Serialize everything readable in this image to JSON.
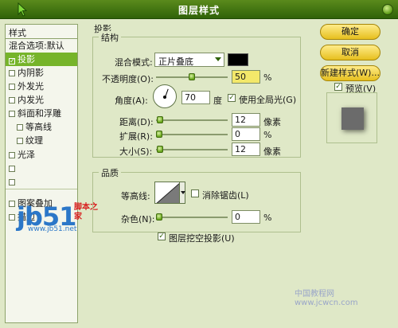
{
  "window": {
    "title": "图层样式"
  },
  "left_panel": {
    "header": "样式",
    "items": [
      {
        "label": "混合选项:默认",
        "checkbox": false,
        "sub": false,
        "selected": false
      },
      {
        "label": "投影",
        "checkbox": true,
        "checked": true,
        "sub": false,
        "selected": true
      },
      {
        "label": "内阴影",
        "checkbox": true,
        "checked": false,
        "sub": false,
        "selected": false
      },
      {
        "label": "外发光",
        "checkbox": true,
        "checked": false,
        "sub": false,
        "selected": false
      },
      {
        "label": "内发光",
        "checkbox": true,
        "checked": false,
        "sub": false,
        "selected": false
      },
      {
        "label": "斜面和浮雕",
        "checkbox": true,
        "checked": false,
        "sub": false,
        "selected": false
      },
      {
        "label": "等高线",
        "checkbox": true,
        "checked": false,
        "sub": true,
        "selected": false
      },
      {
        "label": "纹理",
        "checkbox": true,
        "checked": false,
        "sub": true,
        "selected": false
      },
      {
        "label": "光泽",
        "checkbox": true,
        "checked": false,
        "sub": false,
        "selected": false
      },
      {
        "label": "",
        "checkbox": true,
        "checked": false,
        "sub": false,
        "selected": false
      },
      {
        "label": "",
        "checkbox": true,
        "checked": false,
        "sub": false,
        "selected": false
      },
      {
        "label": "图案叠加",
        "checkbox": true,
        "checked": false,
        "sub": false,
        "selected": false
      },
      {
        "label": "描边",
        "checkbox": true,
        "checked": false,
        "sub": false,
        "selected": false
      }
    ]
  },
  "watermark": {
    "logo": "jb51",
    "cn": "脚本之家",
    "url": "www.jb51.net"
  },
  "drop_shadow": {
    "section_title": "投影",
    "structure_title": "结构",
    "blend_mode_label": "混合模式:",
    "blend_mode_value": "正片叠底",
    "color": "#000000",
    "opacity_label": "不透明度(O):",
    "opacity_value": "50",
    "opacity_unit": "%",
    "angle_label": "角度(A):",
    "angle_value": "70",
    "angle_unit": "度",
    "global_light_label": "使用全局光(G)",
    "global_light_checked": true,
    "distance_label": "距离(D):",
    "distance_value": "12",
    "distance_unit": "像素",
    "spread_label": "扩展(R):",
    "spread_value": "0",
    "spread_unit": "%",
    "size_label": "大小(S):",
    "size_value": "12",
    "size_unit": "像素",
    "quality_title": "品质",
    "contour_label": "等高线:",
    "antialias_label": "消除锯齿(L)",
    "antialias_checked": false,
    "noise_label": "杂色(N):",
    "noise_value": "0",
    "noise_unit": "%",
    "knockout_label": "图层挖空投影(U)",
    "knockout_checked": true
  },
  "buttons": {
    "ok": "确定",
    "cancel": "取消",
    "new_style": "新建样式(W)...",
    "preview_label": "预览(V)",
    "preview_checked": true
  },
  "corner_watermark": "中国教程网 www.jcwcn.com",
  "colors": {
    "accent": "#76b42a",
    "titlebar": "#3c7010",
    "button": "#f0cc3a",
    "highlight": "#f3e86a"
  }
}
